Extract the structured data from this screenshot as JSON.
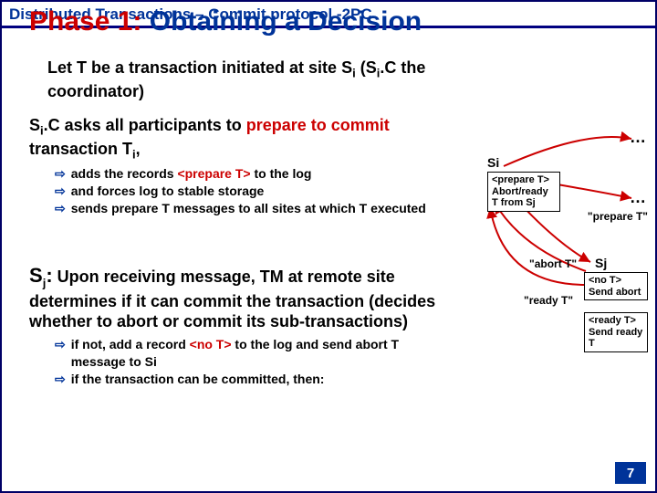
{
  "header": {
    "line": "Distributed Transactions – Commit protocol -2PC"
  },
  "title": {
    "phase": "Phase 1:",
    "rest": " Obtaining a Decision"
  },
  "let_line": {
    "pre": "Let T be a transaction initiated at site S",
    "sub1": "i",
    "mid": " (S",
    "sub2": "i",
    "post": ".C the coordinator)"
  },
  "p1": {
    "s_pre": "S",
    "s_sub": "i",
    "s_post": ".C",
    "text1": " asks all participants to ",
    "red1": "prepare to commit",
    "text2": " transaction T",
    "t_sub": "i",
    "text3": ","
  },
  "bullets1": {
    "b1_a": "adds the records ",
    "b1_red": "<prepare T>",
    "b1_b": " to the log",
    "b2": "and forces log to stable storage",
    "b3": "sends prepare T messages to all sites at which T executed"
  },
  "p2": {
    "lead_pre": "S",
    "lead_sub": "j",
    "lead_post": ":",
    "body": " Upon receiving message, TM at remote site determines if it can commit the transaction (decides whether to abort or commit its sub-transactions)"
  },
  "bullets2": {
    "b1_a": "if not, add a record ",
    "b1_red": "<no T>",
    "b1_b": " to the log and send ",
    "b1_c": "abort T",
    "b1_d": " message to S",
    "b1_sub": "i",
    "b2": "if the transaction can be committed, then:"
  },
  "diagram": {
    "si": "Si",
    "si_box": "<prepare T>\nAbort/ready T from Sj",
    "sj": "Sj",
    "box_no": "<no T>\nSend abort",
    "box_ready": "<ready T>\nSend ready T",
    "lbl_prepare": "\"prepare T\"",
    "lbl_abort": "\"abort T\"",
    "lbl_ready": "\"ready T\"",
    "dots": "…"
  },
  "page": "7"
}
